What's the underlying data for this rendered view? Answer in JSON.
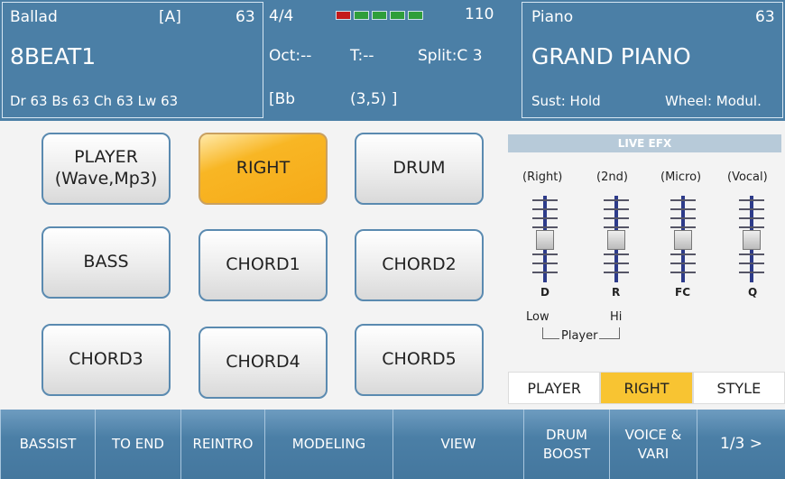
{
  "header": {
    "style_category": "Ballad",
    "style_bank": "[A]",
    "style_num": "63",
    "style_name": "8BEAT1",
    "style_levels": "Dr 63  Bs 63  Ch 63  Lw 63",
    "time_signature": "4/4",
    "tempo": "110",
    "octave": "Oct:--",
    "transpose": "T:--",
    "split": "Split:C 3",
    "chord": "[Bb",
    "chord_pos": "(3,5) ]",
    "beat_leds": [
      "#c41a1a",
      "#2f9e3a",
      "#2f9e3a",
      "#2f9e3a",
      "#2f9e3a"
    ],
    "voice_category": "Piano",
    "voice_num": "63",
    "voice_name": "GRAND PIANO",
    "sustain": "Sust: Hold",
    "wheel": "Wheel: Modul."
  },
  "grid": {
    "player": "PLAYER\n(Wave,Mp3)",
    "right": "RIGHT",
    "drum": "DRUM",
    "bass": "BASS",
    "chord1": "CHORD1",
    "chord2": "CHORD2",
    "chord3": "CHORD3",
    "chord4": "CHORD4",
    "chord5": "CHORD5"
  },
  "live_efx": {
    "title": "LIVE EFX",
    "col_right": "(Right)",
    "col_2nd": "(2nd)",
    "col_micro": "(Micro)",
    "col_vocal": "(Vocal)",
    "letter_right": "D",
    "letter_2nd": "R",
    "letter_micro": "FC",
    "letter_vocal": "Q",
    "low": "Low",
    "hi": "Hi",
    "player": "Player"
  },
  "tabs": {
    "player": "PLAYER",
    "right": "RIGHT",
    "style": "STYLE"
  },
  "footer": {
    "bassist": "BASSIST",
    "to_end": "TO END",
    "reintro": "REINTRO",
    "modeling": "MODELING",
    "view": "VIEW",
    "drum_boost": "DRUM\nBOOST",
    "voice_vari": "VOICE &\nVARI",
    "page": "1/3 >"
  },
  "colors": {
    "accent": "#4b7fa6",
    "active": "#f8b624"
  }
}
